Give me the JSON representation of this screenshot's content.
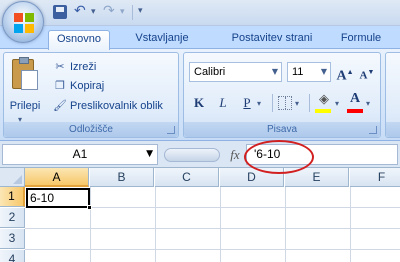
{
  "quick_access": {
    "office_button": "office-button",
    "items": [
      "save-icon",
      "undo-icon",
      "redo-icon",
      "customize-icon"
    ]
  },
  "tabs": [
    {
      "label": "Osnovno",
      "active": true
    },
    {
      "label": "Vstavljanje",
      "active": false
    },
    {
      "label": "Postavitev strani",
      "active": false
    },
    {
      "label": "Formule",
      "active": false
    }
  ],
  "clipboard": {
    "paste_label": "Prilepi",
    "cut_label": "Izreži",
    "copy_label": "Kopiraj",
    "format_painter_label": "Preslikovalnik oblik",
    "group_label": "Odložišče"
  },
  "font": {
    "name": "Calibri",
    "size": "11",
    "grow_label": "A",
    "shrink_label": "A",
    "bold_label": "K",
    "italic_label": "L",
    "underline_label": "P",
    "font_color_label": "A",
    "fill_color": "#ffff00",
    "font_color": "#ff0000",
    "group_label": "Pisava"
  },
  "formula_bar": {
    "name_box": "A1",
    "fx_label": "fx",
    "content": "'6-10"
  },
  "grid": {
    "columns": [
      "A",
      "B",
      "C",
      "D",
      "E",
      "F"
    ],
    "rows": [
      "1",
      "2",
      "3",
      "4"
    ],
    "selected_cell": "A1",
    "cells": {
      "A1": "6-10"
    }
  },
  "colors": {
    "ribbon_tab_bar": "#bfdbff",
    "highlight_annotation": "#d22020",
    "selection_header": "#f7c86a"
  }
}
